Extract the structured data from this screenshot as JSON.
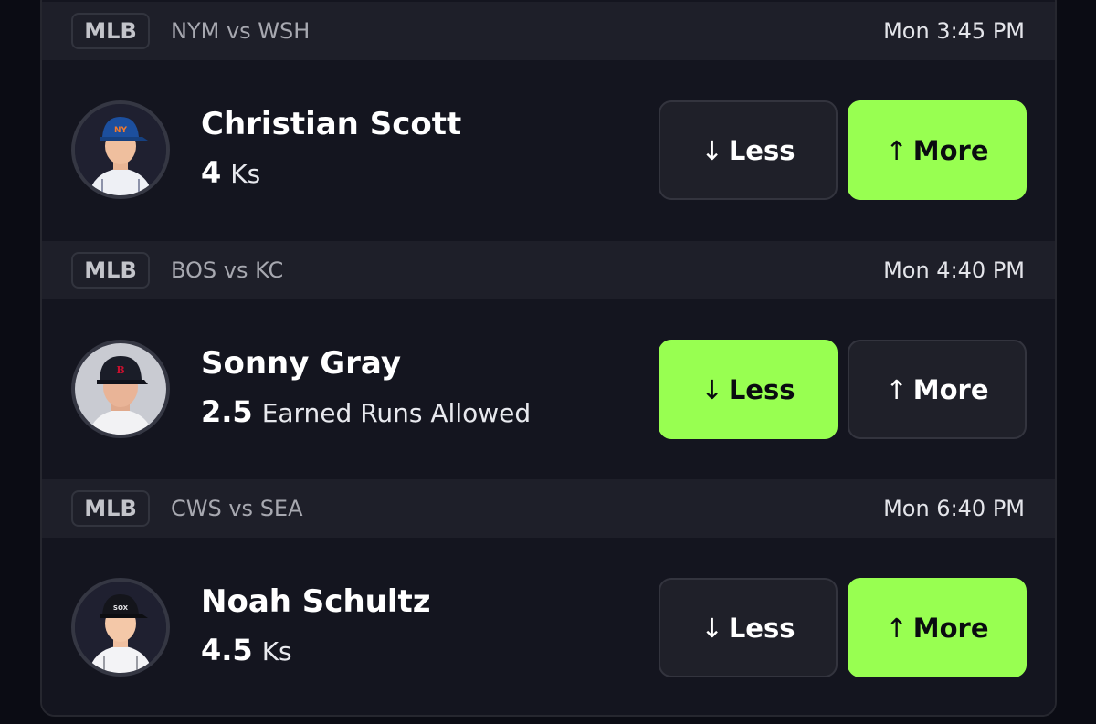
{
  "games": [
    {
      "league": "MLB",
      "matchup": "NYM vs WSH",
      "time": "Mon 3:45 PM",
      "player": "Christian Scott",
      "line": "4",
      "stat": "Ks",
      "cap": "NY",
      "less_label": "Less",
      "more_label": "More",
      "less_arrow": "↓",
      "more_arrow": "↑",
      "selected": "more"
    },
    {
      "league": "MLB",
      "matchup": "BOS vs KC",
      "time": "Mon 4:40 PM",
      "player": "Sonny Gray",
      "line": "2.5",
      "stat": "Earned Runs Allowed",
      "cap": "B",
      "less_label": "Less",
      "more_label": "More",
      "less_arrow": "↓",
      "more_arrow": "↑",
      "selected": "less"
    },
    {
      "league": "MLB",
      "matchup": "CWS vs SEA",
      "time": "Mon 6:40 PM",
      "player": "Noah Schultz",
      "line": "4.5",
      "stat": "Ks",
      "cap": "SOX",
      "less_label": "Less",
      "more_label": "More",
      "less_arrow": "↓",
      "more_arrow": "↑",
      "selected": "more"
    }
  ],
  "colors": {
    "accent": "#98ff51",
    "card": "#14151f",
    "header": "#1e1f29",
    "button": "#1f2029"
  }
}
